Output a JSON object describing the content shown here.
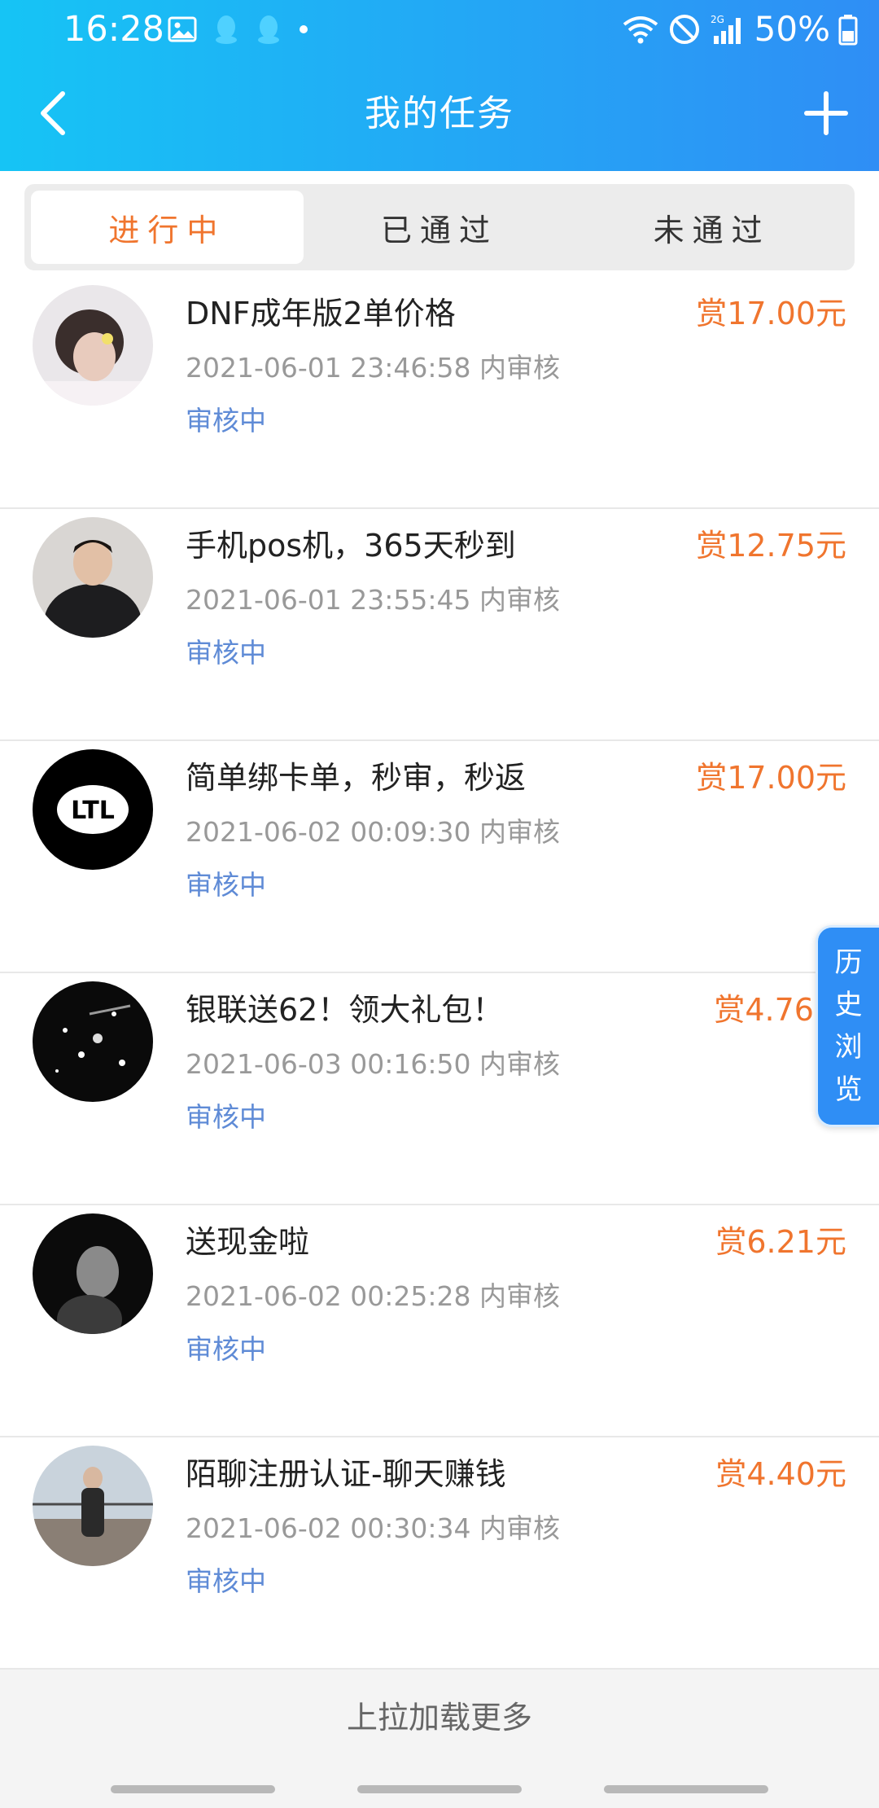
{
  "status_bar": {
    "time": "16:28",
    "battery": "50%",
    "network": "2G",
    "icons": [
      "image-icon",
      "qq-icon",
      "qq-icon",
      "dot-icon",
      "wifi-icon",
      "do-not-disturb-icon",
      "signal-icon",
      "battery-icon"
    ]
  },
  "header": {
    "title": "我的任务",
    "back_icon": "chevron-left-icon",
    "add_icon": "plus-icon"
  },
  "tabs": [
    {
      "label": "进行中",
      "active": true
    },
    {
      "label": "已通过",
      "active": false
    },
    {
      "label": "未通过",
      "active": false
    }
  ],
  "tasks": [
    {
      "title": "DNF成年版2单价格",
      "reward": "赏17.00元",
      "time": "2021-06-01 23:46:58 内审核",
      "status": "审核中"
    },
    {
      "title": "手机pos机，365天秒到",
      "reward": "赏12.75元",
      "time": "2021-06-01 23:55:45 内审核",
      "status": "审核中"
    },
    {
      "title": "简单绑卡单，秒审，秒返",
      "reward": "赏17.00元",
      "time": "2021-06-02 00:09:30 内审核",
      "status": "审核中",
      "avatar_text": "LTL"
    },
    {
      "title": "银联送62！领大礼包！",
      "reward": "赏4.76",
      "time": "2021-06-03 00:16:50 内审核",
      "status": "审核中"
    },
    {
      "title": "送现金啦",
      "reward": "赏6.21元",
      "time": "2021-06-02 00:25:28 内审核",
      "status": "审核中"
    },
    {
      "title": "陌聊注册认证-聊天赚钱",
      "reward": "赏4.40元",
      "time": "2021-06-02 00:30:34 内审核",
      "status": "审核中"
    }
  ],
  "load_more": "上拉加载更多",
  "history_button": [
    "历",
    "史",
    "浏",
    "览"
  ],
  "colors": {
    "header_start": "#16c4f5",
    "header_end": "#2f8ef5",
    "accent": "#f0752e",
    "status_text": "#5f8bd6"
  }
}
